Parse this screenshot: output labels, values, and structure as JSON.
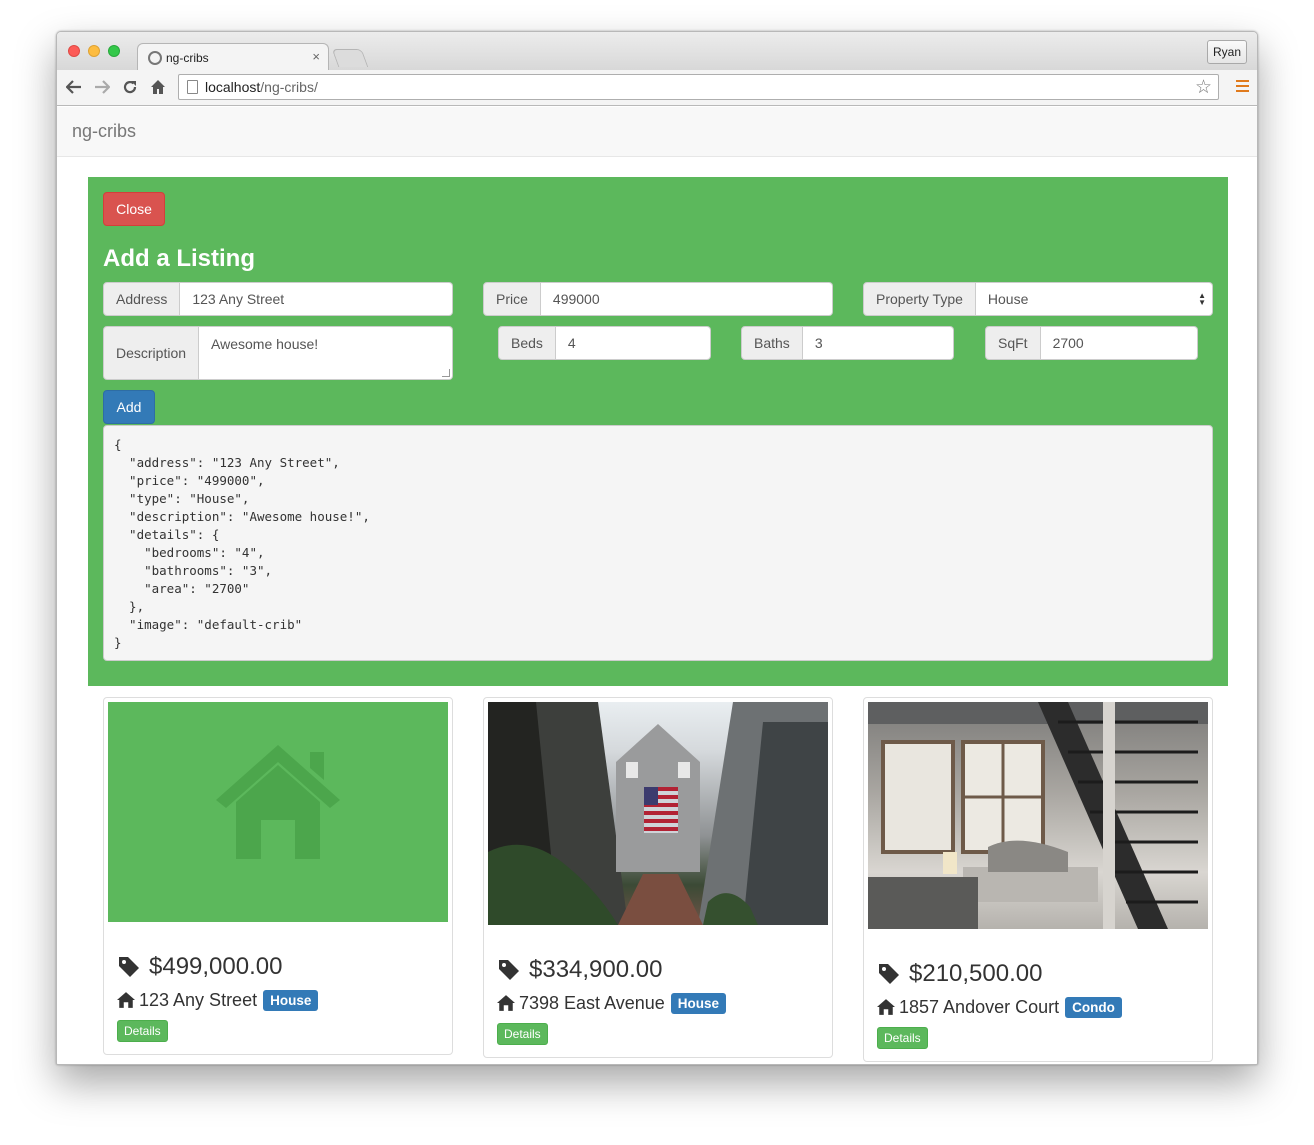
{
  "browser": {
    "tab_title": "ng-cribs",
    "tab_close": "×",
    "user_name": "Ryan",
    "url_host": "localhost",
    "url_path": "/ng-cribs/"
  },
  "app": {
    "brand": "ng-cribs"
  },
  "form": {
    "close_label": "Close",
    "title": "Add a Listing",
    "address_label": "Address",
    "address_value": "123 Any Street",
    "price_label": "Price",
    "price_value": "499000",
    "type_label": "Property Type",
    "type_value": "House",
    "description_label": "Description",
    "description_value": "Awesome house!",
    "beds_label": "Beds",
    "beds_value": "4",
    "baths_label": "Baths",
    "baths_value": "3",
    "sqft_label": "SqFt",
    "sqft_value": "2700",
    "add_label": "Add",
    "json_preview": "{\n  \"address\": \"123 Any Street\",\n  \"price\": \"499000\",\n  \"type\": \"House\",\n  \"description\": \"Awesome house!\",\n  \"details\": {\n    \"bedrooms\": \"4\",\n    \"bathrooms\": \"3\",\n    \"area\": \"2700\"\n  },\n  \"image\": \"default-crib\"\n}"
  },
  "listings": [
    {
      "price": "$499,000.00",
      "address": "123 Any Street",
      "type": "House",
      "details_label": "Details"
    },
    {
      "price": "$334,900.00",
      "address": "7398 East Avenue",
      "type": "House",
      "details_label": "Details"
    },
    {
      "price": "$210,500.00",
      "address": "1857 Andover Court",
      "type": "Condo",
      "details_label": "Details"
    }
  ],
  "colors": {
    "panel_green": "#5cb85c",
    "danger_red": "#d9534f",
    "primary_blue": "#337ab7"
  },
  "icons": {
    "price": "tag-icon",
    "address": "home-icon",
    "placeholder": "home-icon"
  }
}
